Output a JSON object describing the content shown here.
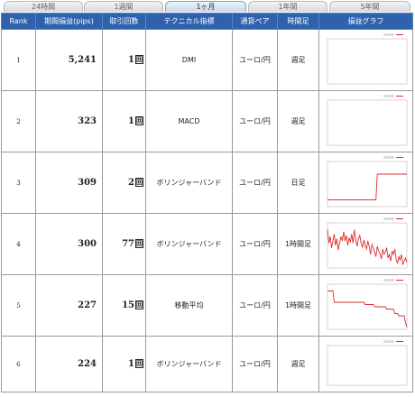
{
  "tabs": [
    {
      "label": "24時間",
      "active": false
    },
    {
      "label": "1週間",
      "active": false
    },
    {
      "label": "1ヶ月",
      "active": true
    },
    {
      "label": "1年間",
      "active": false
    },
    {
      "label": "5年間",
      "active": false
    }
  ],
  "headers": {
    "rank": "Rank",
    "pips": "期間損益(pips)",
    "trades": "取引回数",
    "indicator": "テクニカル指標",
    "pair": "通貨ペア",
    "timeframe": "時間足",
    "graph": "損益グラフ"
  },
  "trade_unit": "回",
  "rows": [
    {
      "rank": "1",
      "pips": "5,241",
      "trades": "1",
      "indicator": "DMI",
      "pair": "ユーロ/円",
      "timeframe": "週足",
      "graph": []
    },
    {
      "rank": "2",
      "pips": "323",
      "trades": "1",
      "indicator": "MACD",
      "pair": "ユーロ/円",
      "timeframe": "週足",
      "graph": []
    },
    {
      "rank": "3",
      "pips": "309",
      "trades": "2",
      "indicator": "ボリンジャーバンド",
      "pair": "ユーロ/円",
      "timeframe": "日足",
      "graph": [
        0.15,
        0.15,
        0.15,
        0.15,
        0.15,
        0.15,
        0.15,
        0.15,
        0.15,
        0.15,
        0.15,
        0.15,
        0.15,
        0.15,
        0.15,
        0.15,
        0.15,
        0.15,
        0.15,
        0.15,
        0.15,
        0.15,
        0.15,
        0.15,
        0.15,
        0.15,
        0.15,
        0.15,
        0.15,
        0.15,
        0.15,
        0.15,
        0.15,
        0.15,
        0.15,
        0.15,
        0.15,
        0.72,
        0.72,
        0.72,
        0.72,
        0.72,
        0.72,
        0.72,
        0.72,
        0.72,
        0.72,
        0.72,
        0.72,
        0.72,
        0.72,
        0.72,
        0.72,
        0.72,
        0.72,
        0.72,
        0.72,
        0.72,
        0.72,
        0.72
      ]
    },
    {
      "rank": "4",
      "pips": "300",
      "trades": "77",
      "indicator": "ボリンジャーバンド",
      "pair": "ユーロ/円",
      "timeframe": "1時間足",
      "graph": [
        0.85,
        0.55,
        0.7,
        0.45,
        0.6,
        0.75,
        0.5,
        0.65,
        0.4,
        0.55,
        0.7,
        0.6,
        0.8,
        0.6,
        0.72,
        0.5,
        0.66,
        0.58,
        0.75,
        0.55,
        0.85,
        0.62,
        0.48,
        0.65,
        0.72,
        0.55,
        0.45,
        0.62,
        0.5,
        0.42,
        0.6,
        0.48,
        0.3,
        0.52,
        0.45,
        0.35,
        0.25,
        0.48,
        0.38,
        0.32,
        0.2,
        0.42,
        0.3,
        0.35,
        0.45,
        0.22,
        0.3,
        0.15,
        0.38,
        0.3,
        0.42,
        0.2,
        0.1,
        0.25,
        0.18,
        0.3,
        0.08,
        0.15,
        0.22,
        0.12
      ]
    },
    {
      "rank": "5",
      "pips": "227",
      "trades": "15",
      "indicator": "移動平均",
      "pair": "ユーロ/円",
      "timeframe": "1時間足",
      "graph": [
        0.85,
        0.85,
        0.85,
        0.85,
        0.85,
        0.6,
        0.6,
        0.6,
        0.6,
        0.6,
        0.6,
        0.6,
        0.6,
        0.6,
        0.6,
        0.6,
        0.6,
        0.6,
        0.6,
        0.6,
        0.6,
        0.6,
        0.6,
        0.6,
        0.6,
        0.6,
        0.6,
        0.6,
        0.55,
        0.55,
        0.55,
        0.55,
        0.55,
        0.55,
        0.55,
        0.5,
        0.5,
        0.5,
        0.5,
        0.5,
        0.5,
        0.5,
        0.5,
        0.5,
        0.45,
        0.45,
        0.45,
        0.45,
        0.45,
        0.45,
        0.35,
        0.35,
        0.35,
        0.3,
        0.3,
        0.3,
        0.3,
        0.3,
        0.15,
        0.05
      ]
    },
    {
      "rank": "6",
      "pips": "224",
      "trades": "1",
      "indicator": "ボリンジャーバンド",
      "pair": "ユーロ/円",
      "timeframe": "週足",
      "graph": []
    }
  ]
}
